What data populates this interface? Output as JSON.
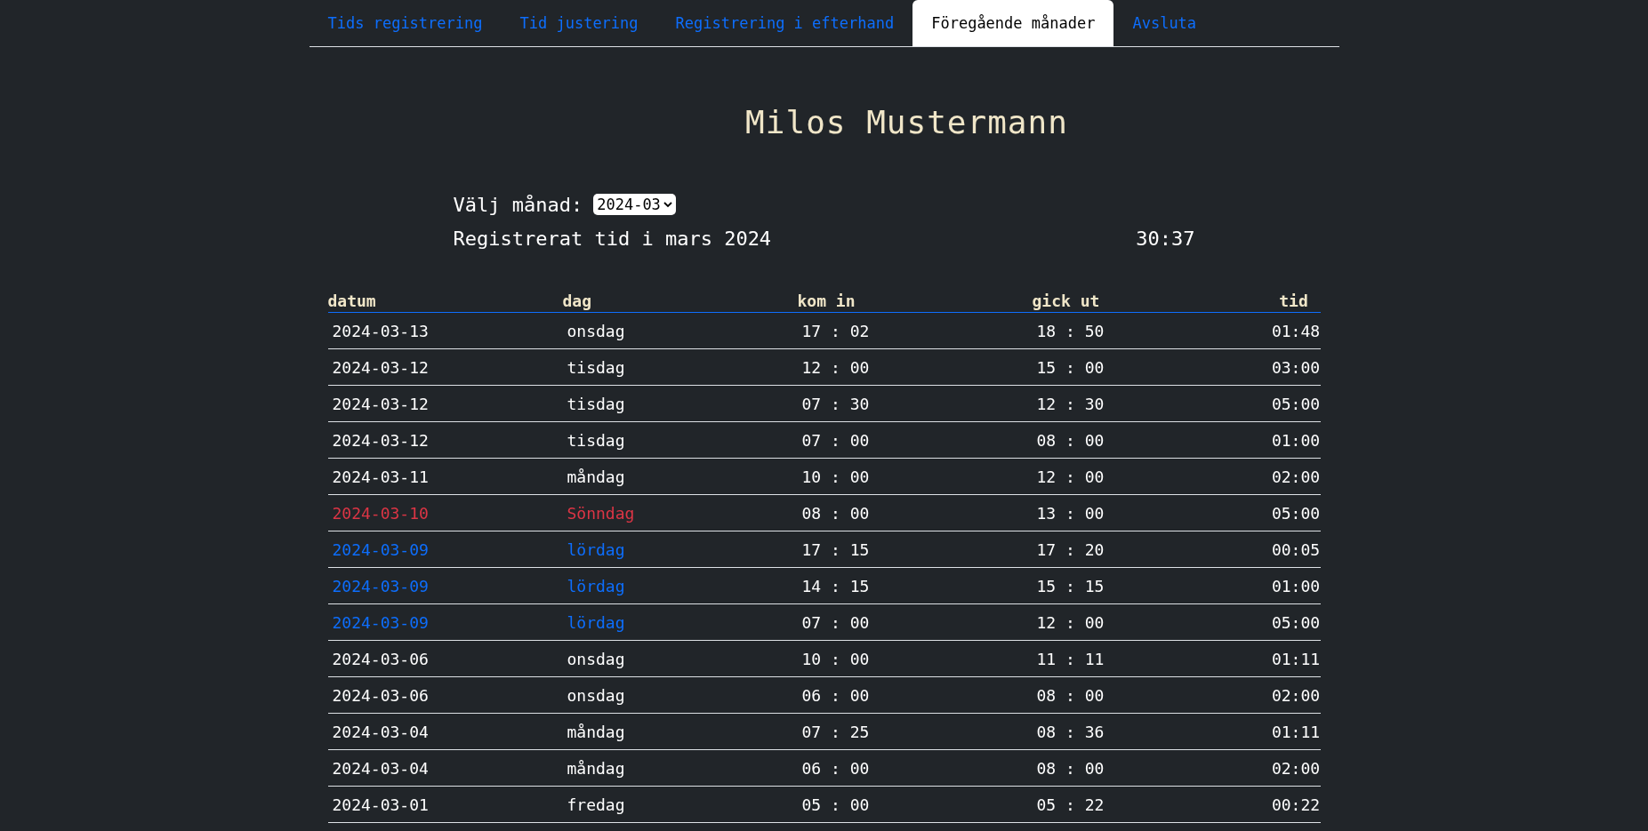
{
  "nav": [
    {
      "label": "Tids registrering",
      "selected": false
    },
    {
      "label": "Tid justering",
      "selected": false
    },
    {
      "label": "Registrering i efterhand",
      "selected": false
    },
    {
      "label": "Föregående månader",
      "selected": true
    },
    {
      "label": "Avsluta",
      "selected": false
    }
  ],
  "user_name": "Milos Mustermann",
  "month_select": {
    "label": "Välj månad:",
    "value": "2024-03"
  },
  "summary": {
    "label": "Registrerat tid i mars 2024",
    "total": "30:37"
  },
  "table": {
    "columns": [
      "datum",
      "dag",
      "kom in",
      "gick ut",
      "tid"
    ],
    "rows": [
      {
        "kind": "weekday",
        "date": "2024-03-13",
        "day": "onsdag",
        "in": "17 : 02",
        "out": "18 : 50",
        "time": "01:48"
      },
      {
        "kind": "weekday",
        "date": "2024-03-12",
        "day": "tisdag",
        "in": "12 : 00",
        "out": "15 : 00",
        "time": "03:00"
      },
      {
        "kind": "weekday",
        "date": "2024-03-12",
        "day": "tisdag",
        "in": "07 : 30",
        "out": "12 : 30",
        "time": "05:00"
      },
      {
        "kind": "weekday",
        "date": "2024-03-12",
        "day": "tisdag",
        "in": "07 : 00",
        "out": "08 : 00",
        "time": "01:00"
      },
      {
        "kind": "weekday",
        "date": "2024-03-11",
        "day": "måndag",
        "in": "10 : 00",
        "out": "12 : 00",
        "time": "02:00"
      },
      {
        "kind": "sunday",
        "date": "2024-03-10",
        "day": "Sönndag",
        "in": "08 : 00",
        "out": "13 : 00",
        "time": "05:00"
      },
      {
        "kind": "saturday",
        "date": "2024-03-09",
        "day": "lördag",
        "in": "17 : 15",
        "out": "17 : 20",
        "time": "00:05"
      },
      {
        "kind": "saturday",
        "date": "2024-03-09",
        "day": "lördag",
        "in": "14 : 15",
        "out": "15 : 15",
        "time": "01:00"
      },
      {
        "kind": "saturday",
        "date": "2024-03-09",
        "day": "lördag",
        "in": "07 : 00",
        "out": "12 : 00",
        "time": "05:00"
      },
      {
        "kind": "weekday",
        "date": "2024-03-06",
        "day": "onsdag",
        "in": "10 : 00",
        "out": "11 : 11",
        "time": "01:11"
      },
      {
        "kind": "weekday",
        "date": "2024-03-06",
        "day": "onsdag",
        "in": "06 : 00",
        "out": "08 : 00",
        "time": "02:00"
      },
      {
        "kind": "weekday",
        "date": "2024-03-04",
        "day": "måndag",
        "in": "07 : 25",
        "out": "08 : 36",
        "time": "01:11"
      },
      {
        "kind": "weekday",
        "date": "2024-03-04",
        "day": "måndag",
        "in": "06 : 00",
        "out": "08 : 00",
        "time": "02:00"
      },
      {
        "kind": "weekday",
        "date": "2024-03-01",
        "day": "fredag",
        "in": "05 : 00",
        "out": "05 : 22",
        "time": "00:22"
      }
    ]
  }
}
